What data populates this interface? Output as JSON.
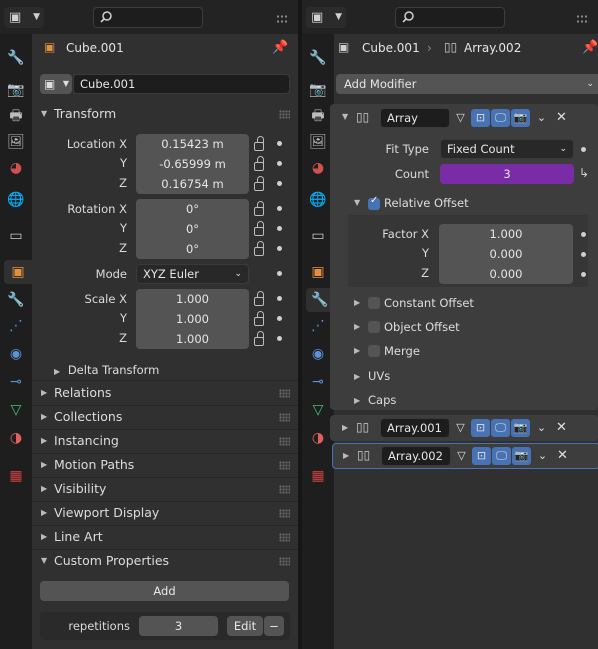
{
  "icons": {
    "editor_type": "properties-editor-icon",
    "dropdown": "chevron-down-icon",
    "search": "search-icon",
    "pin": "pin-icon",
    "close": "close-icon",
    "lock": "lock-icon",
    "dot": "animate-keyframe-dot-icon"
  },
  "colors": {
    "accent": "#4772b3",
    "count_field": "#7a2ba6",
    "panel_bg": "#303030",
    "tab_active": "#e3903d"
  },
  "left": {
    "context_label": "Cube.001",
    "object_name": "Cube.001",
    "tabs": [
      "tool",
      "render",
      "output",
      "view-layer",
      "scene",
      "world",
      "collection",
      "object",
      "modifier",
      "particles",
      "physics",
      "constraints",
      "data",
      "material",
      "texture"
    ],
    "transform": {
      "title": "Transform",
      "location": {
        "label": "Location X",
        "y_label": "Y",
        "z_label": "Z",
        "x": "0.15423 m",
        "y": "-0.65999 m",
        "z": "0.16754 m"
      },
      "rotation": {
        "label": "Rotation X",
        "y_label": "Y",
        "z_label": "Z",
        "x": "0°",
        "y": "0°",
        "z": "0°"
      },
      "mode": {
        "label": "Mode",
        "value": "XYZ Euler"
      },
      "scale": {
        "label": "Scale X",
        "y_label": "Y",
        "z_label": "Z",
        "x": "1.000",
        "y": "1.000",
        "z": "1.000"
      },
      "delta": "Delta Transform"
    },
    "panels": [
      "Relations",
      "Collections",
      "Instancing",
      "Motion Paths",
      "Visibility",
      "Viewport Display",
      "Line Art",
      "Custom Properties"
    ],
    "custom_props": {
      "add_label": "Add",
      "prop_name": "repetitions",
      "prop_value": "3",
      "edit_label": "Edit",
      "remove_label": "−"
    }
  },
  "right": {
    "breadcrumb_object": "Cube.001",
    "breadcrumb_sep": "›",
    "breadcrumb_modifier": "Array.002",
    "add_modifier": "Add Modifier",
    "modifiers": [
      {
        "name": "Array",
        "expanded": true
      },
      {
        "name": "Array.001",
        "expanded": false
      },
      {
        "name": "Array.002",
        "expanded": false
      }
    ],
    "array": {
      "fit_type_label": "Fit Type",
      "fit_type_value": "Fixed Count",
      "count_label": "Count",
      "count_value": "3",
      "relative_offset": "Relative Offset",
      "factor_x_label": "Factor X",
      "factor_y_label": "Y",
      "factor_z_label": "Z",
      "factor_x": "1.000",
      "factor_y": "0.000",
      "factor_z": "0.000",
      "constant_offset": "Constant Offset",
      "object_offset": "Object Offset",
      "merge": "Merge",
      "uvs": "UVs",
      "caps": "Caps"
    }
  }
}
